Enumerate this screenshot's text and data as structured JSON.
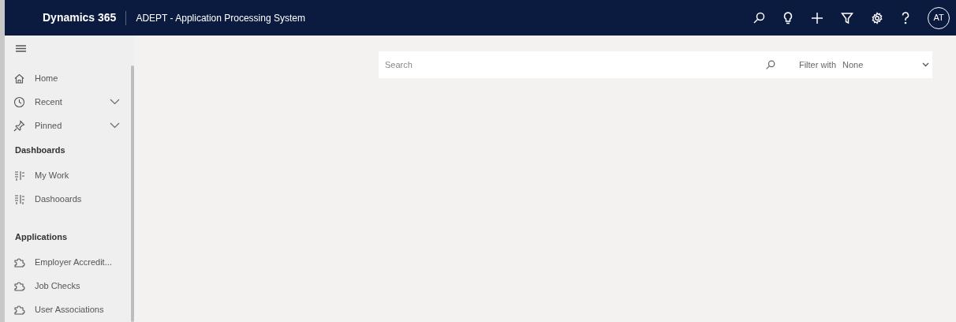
{
  "top_bar": {
    "product": "Dynamics 365",
    "app_title": "ADEPT - Application Processing System",
    "avatar": "AT"
  },
  "sidebar": {
    "items": [
      {
        "kind": "nav",
        "label": "Home",
        "expandable": false
      },
      {
        "kind": "nav",
        "label": "Recent",
        "expandable": true
      },
      {
        "kind": "nav",
        "label": "Pinned",
        "expandable": true
      },
      {
        "kind": "header",
        "label": "Dashboards"
      },
      {
        "kind": "nav",
        "label": "My Work",
        "expandable": false
      },
      {
        "kind": "nav",
        "label": "Dashooards",
        "expandable": false
      },
      {
        "kind": "header",
        "label": "Applications"
      },
      {
        "kind": "nav",
        "label": "Employer Accredit...",
        "expandable": false
      },
      {
        "kind": "nav",
        "label": "Job Checks",
        "expandable": false
      },
      {
        "kind": "nav",
        "label": "User Associations",
        "expandable": false
      }
    ]
  },
  "search": {
    "placeholder": "Search",
    "filter_label": "Filter with",
    "filter_value": "None"
  }
}
